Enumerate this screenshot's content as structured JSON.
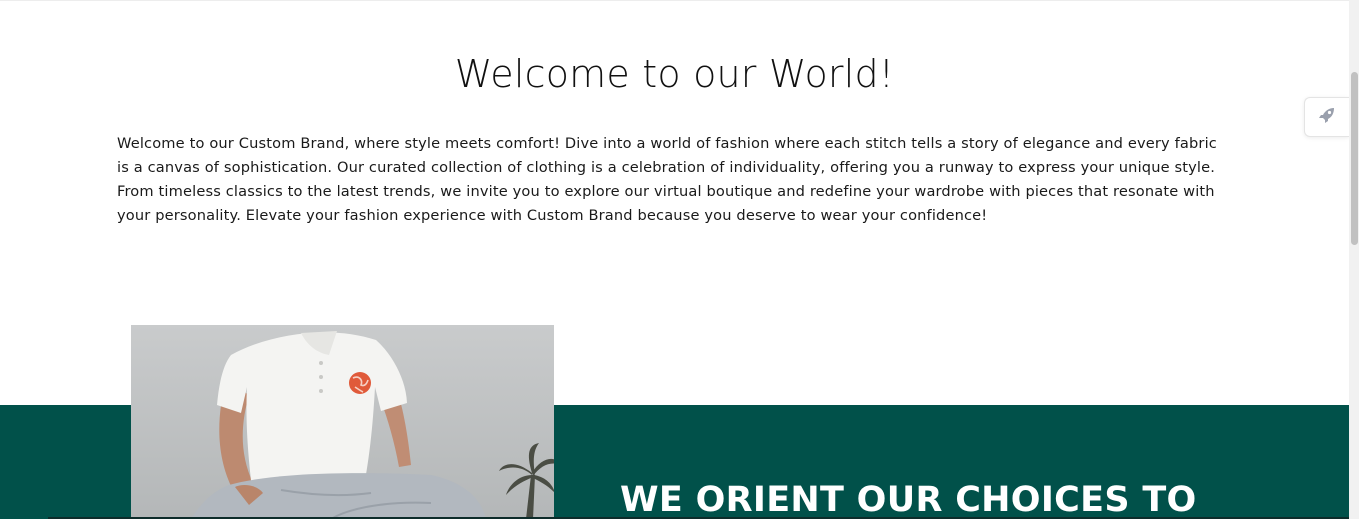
{
  "welcome": {
    "title": "Welcome to our World!",
    "text": "Welcome to our Custom Brand, where style meets comfort! Dive into a world of fashion where each stitch tells a story of elegance and every fabric is a canvas of sophistication. Our curated collection of clothing is a celebration of individuality, offering you a runway to express your unique style. From timeless classics to the latest trends, we invite you to explore our virtual boutique and redefine your wardrobe with pieces that resonate with your personality. Elevate your fashion experience with Custom Brand because you deserve to wear your confidence!"
  },
  "feature": {
    "heading": "WE ORIENT OUR CHOICES TO",
    "image_icon": "model-photo"
  },
  "floating_button": {
    "icon": "rocket-icon"
  },
  "colors": {
    "band": "#01514a",
    "text": "#1a1a1a",
    "heading_on_band": "#ffffff"
  }
}
